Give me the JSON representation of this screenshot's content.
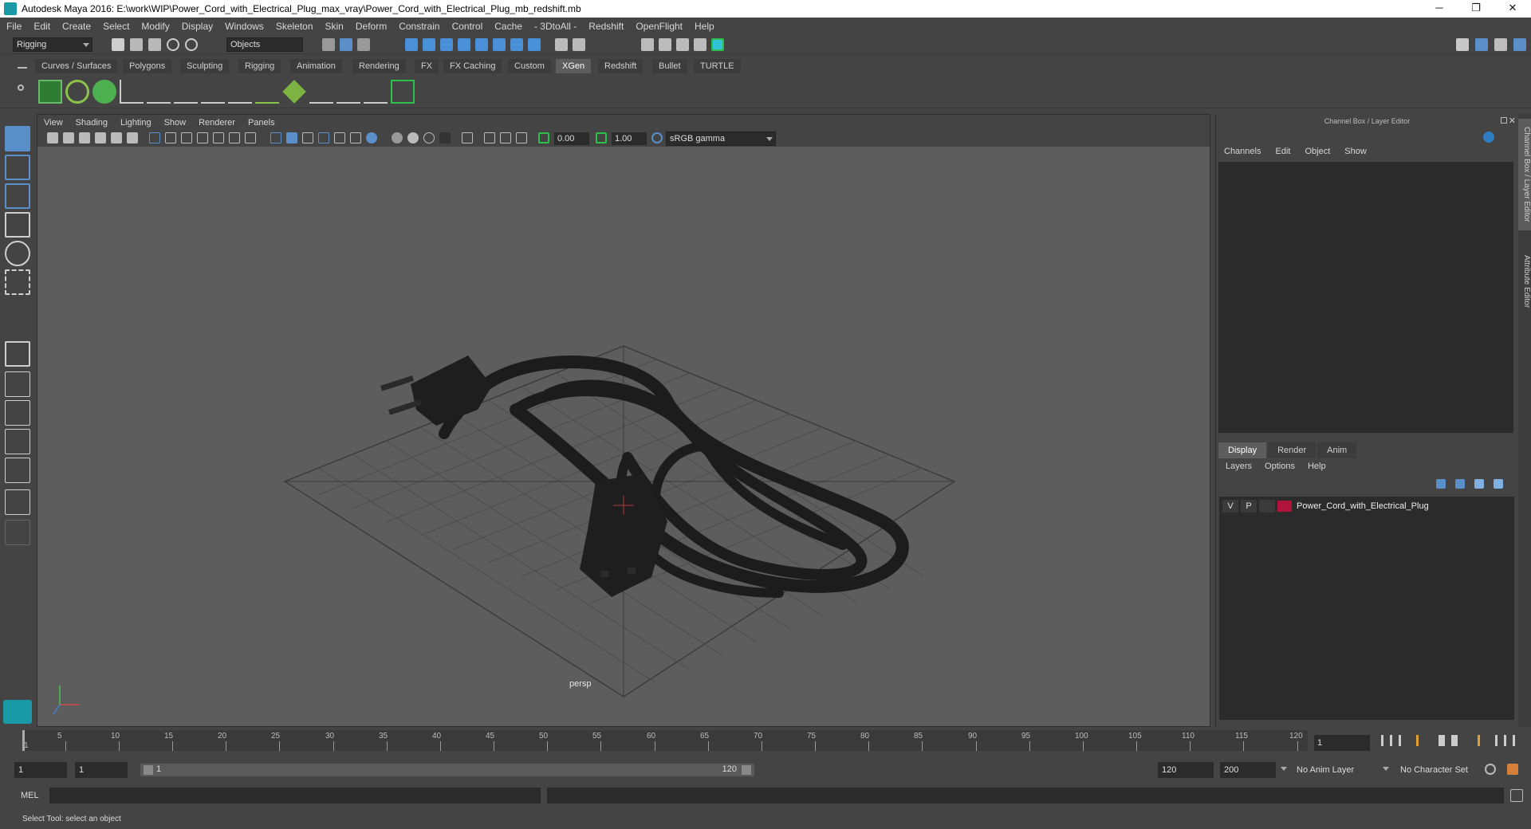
{
  "window": {
    "title": "Autodesk Maya 2016: E:\\work\\WIP\\Power_Cord_with_Electrical_Plug_max_vray\\Power_Cord_with_Electrical_Plug_mb_redshift.mb",
    "minimize": "─",
    "maximize": "❐",
    "close": "✕"
  },
  "menubar": [
    "File",
    "Edit",
    "Create",
    "Select",
    "Modify",
    "Display",
    "Windows",
    "Skeleton",
    "Skin",
    "Deform",
    "Constrain",
    "Control",
    "Cache",
    "- 3DtoAll -",
    "Redshift",
    "OpenFlight",
    "Help"
  ],
  "statusline": {
    "menu_set": "Rigging",
    "selection_mode": "Objects"
  },
  "shelf_tabs": [
    "Curves / Surfaces",
    "Polygons",
    "Sculpting",
    "Rigging",
    "Animation",
    "Rendering",
    "FX",
    "FX Caching",
    "Custom",
    "XGen",
    "Redshift",
    "Bullet",
    "TURTLE"
  ],
  "shelf_active_tab": "XGen",
  "viewport": {
    "menu": [
      "View",
      "Shading",
      "Lighting",
      "Show",
      "Renderer",
      "Panels"
    ],
    "exposure": "0.00",
    "gamma": "1.00",
    "color_space": "sRGB gamma",
    "camera_label": "persp"
  },
  "channel_box": {
    "title": "Channel Box / Layer Editor",
    "menu": [
      "Channels",
      "Edit",
      "Object",
      "Show"
    ]
  },
  "layer_editor": {
    "tabs": [
      "Display",
      "Render",
      "Anim"
    ],
    "active_tab": "Display",
    "menu": [
      "Layers",
      "Options",
      "Help"
    ],
    "layers": [
      {
        "visible": "V",
        "playback": "P",
        "name": "Power_Cord_with_Electrical_Plug",
        "color": "#b0133b"
      }
    ]
  },
  "side_tabs": [
    "Channel Box / Layer Editor",
    "Attribute Editor"
  ],
  "timeslider": {
    "ticks": [
      "5",
      "10",
      "15",
      "20",
      "25",
      "30",
      "35",
      "40",
      "45",
      "50",
      "55",
      "60",
      "65",
      "70",
      "75",
      "80",
      "85",
      "90",
      "95",
      "100",
      "105",
      "110",
      "115",
      "120"
    ],
    "start_label": "1",
    "current_frame": "1"
  },
  "range": {
    "start": "1",
    "playback_start": "1",
    "slider_start": "1",
    "slider_end": "120",
    "playback_end": "120",
    "end": "200",
    "anim_layer": "No Anim Layer",
    "character_set": "No Character Set"
  },
  "command_line": {
    "label": "MEL"
  },
  "help_line": "Select Tool: select an object"
}
